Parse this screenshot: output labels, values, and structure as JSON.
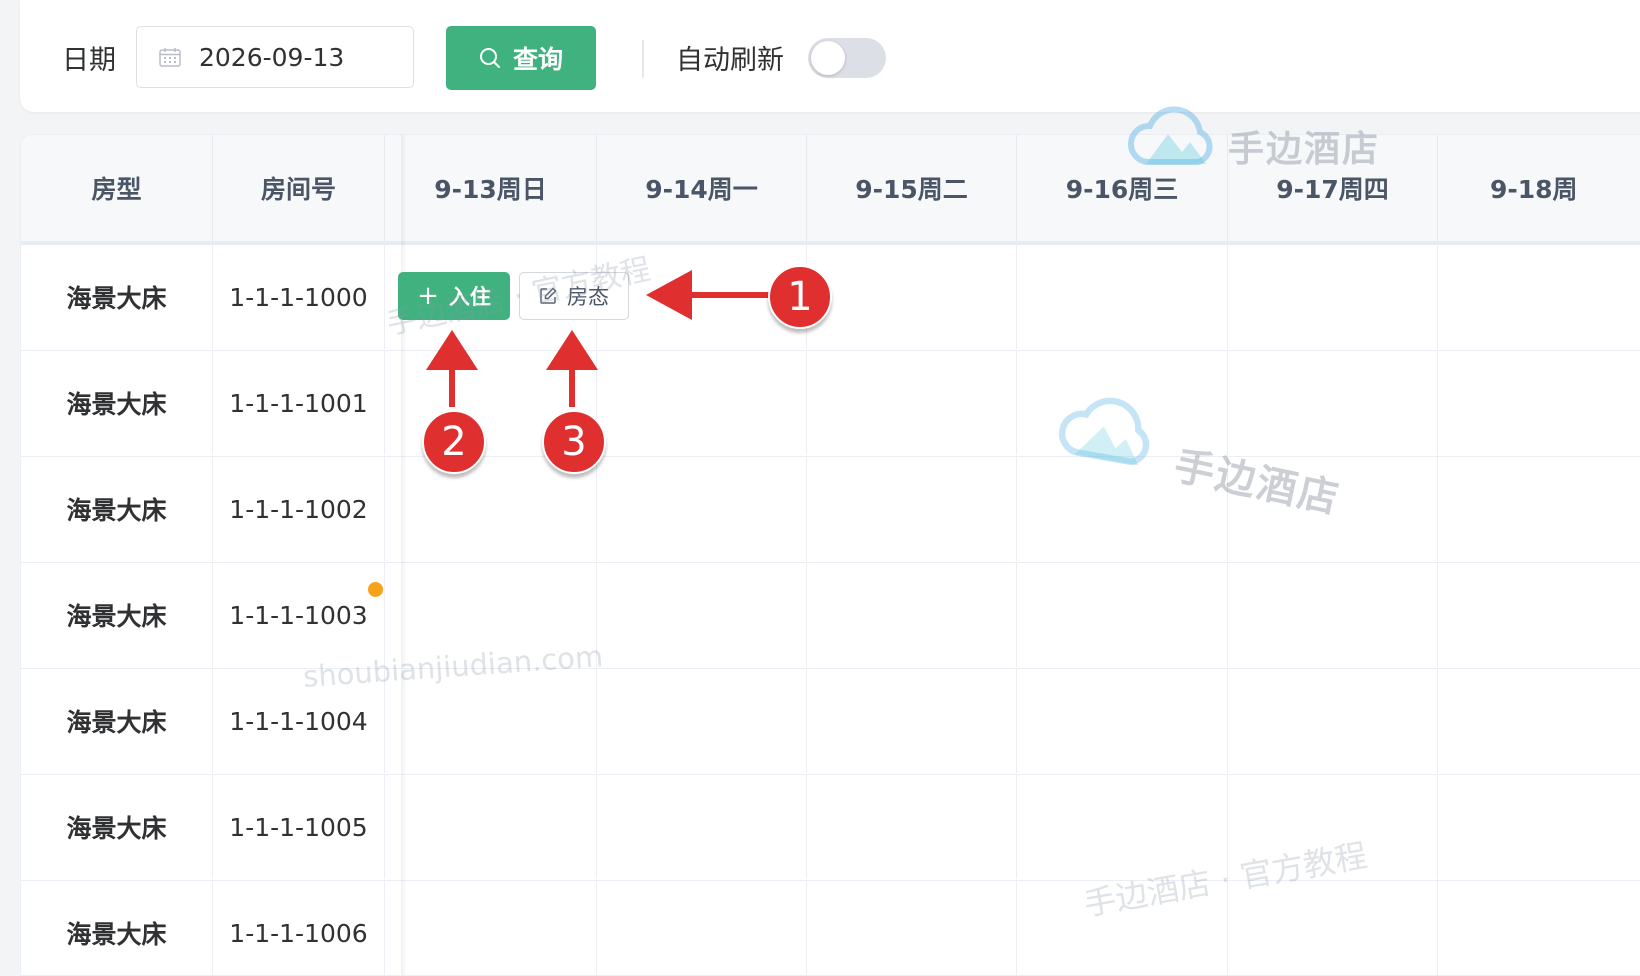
{
  "toolbar": {
    "date_label": "日期",
    "date_value": "2026-09-13",
    "query_label": "查询",
    "auto_refresh_label": "自动刷新",
    "auto_refresh_on": false
  },
  "table": {
    "col_type": "房型",
    "col_room": "房间号",
    "dates": [
      "9-13周日",
      "9-14周一",
      "9-15周二",
      "9-16周三",
      "9-17周四",
      "9-18周"
    ],
    "rows": [
      {
        "type": "海景大床",
        "room": "1-1-1-1000"
      },
      {
        "type": "海景大床",
        "room": "1-1-1-1001"
      },
      {
        "type": "海景大床",
        "room": "1-1-1-1002"
      },
      {
        "type": "海景大床",
        "room": "1-1-1-1003"
      },
      {
        "type": "海景大床",
        "room": "1-1-1-1004"
      },
      {
        "type": "海景大床",
        "room": "1-1-1-1005"
      },
      {
        "type": "海景大床",
        "room": "1-1-1-1006"
      }
    ],
    "status_dot_color": "#f7a21b"
  },
  "actions": {
    "checkin_label": "入住",
    "room_status_label": "房态"
  },
  "watermarks": {
    "brand": "手边酒店",
    "brand_tutorial": "手边酒店 · 官方教程",
    "brand_tutorial_short": "手边酒店 · 官方教程",
    "site": "shoubianjiudian.com"
  },
  "annotations": {
    "badge_1": "1",
    "badge_2": "2",
    "badge_3": "3"
  },
  "colors": {
    "primary": "#3fb27f",
    "annotation_red": "#e02f2f",
    "header_bg": "#f6f8fa"
  }
}
